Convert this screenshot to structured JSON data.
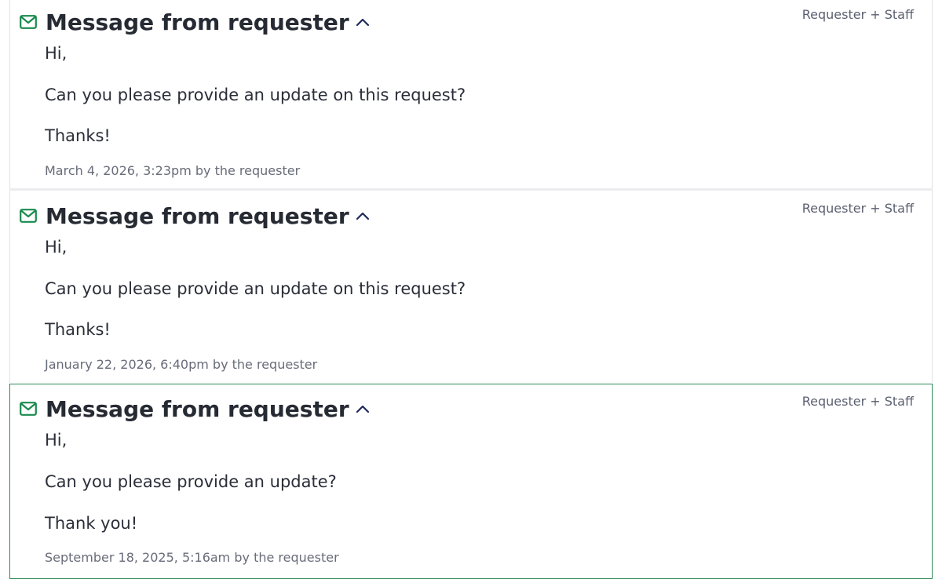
{
  "messages": [
    {
      "title": "Message from requester",
      "visibility": "Requester + Staff",
      "lines": [
        "Hi,",
        "Can you please provide an update on this request?",
        "Thanks!"
      ],
      "meta": "March 4, 2026, 3:23pm by the requester",
      "icon": "mail-icon",
      "toggle_icon": "chevron-up-icon"
    },
    {
      "title": "Message from requester",
      "visibility": "Requester + Staff",
      "lines": [
        "Hi,",
        "Can you please provide an update on this request?",
        "Thanks!"
      ],
      "meta": "January 22, 2026, 6:40pm by the requester",
      "icon": "mail-icon",
      "toggle_icon": "chevron-up-icon"
    },
    {
      "title": "Message from requester",
      "visibility": "Requester + Staff",
      "lines": [
        "Hi,",
        "Can you please provide an update?",
        "Thank you!"
      ],
      "meta": "September 18, 2025, 5:16am by the requester",
      "icon": "mail-icon",
      "toggle_icon": "chevron-up-icon",
      "highlighted": true
    }
  ],
  "colors": {
    "accent_green": "#1a8a4e",
    "chevron_navy": "#1f2a5c",
    "highlight_border": "#2e8b57"
  }
}
